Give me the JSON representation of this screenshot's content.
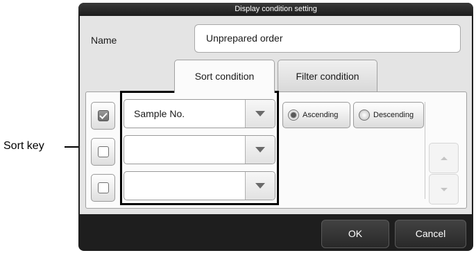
{
  "callout": {
    "label": "Sort key"
  },
  "dialog": {
    "title": "Display condition setting",
    "name_label": "Name",
    "name_value": "Unprepared order",
    "tabs": [
      {
        "label": "Sort condition",
        "active": true
      },
      {
        "label": "Filter condition",
        "active": false
      }
    ],
    "rows": [
      {
        "checked": true,
        "key": "Sample No."
      },
      {
        "checked": false,
        "key": ""
      },
      {
        "checked": false,
        "key": ""
      }
    ],
    "order": {
      "ascending": "Ascending",
      "descending": "Descending",
      "selected": "Ascending"
    },
    "buttons": {
      "ok": "OK",
      "cancel": "Cancel"
    }
  },
  "icons": [
    "checkbox-checked-icon",
    "checkbox-icon",
    "dropdown-arrow-icon",
    "radio-selected-icon",
    "radio-icon",
    "scroll-up-icon",
    "scroll-down-icon"
  ]
}
